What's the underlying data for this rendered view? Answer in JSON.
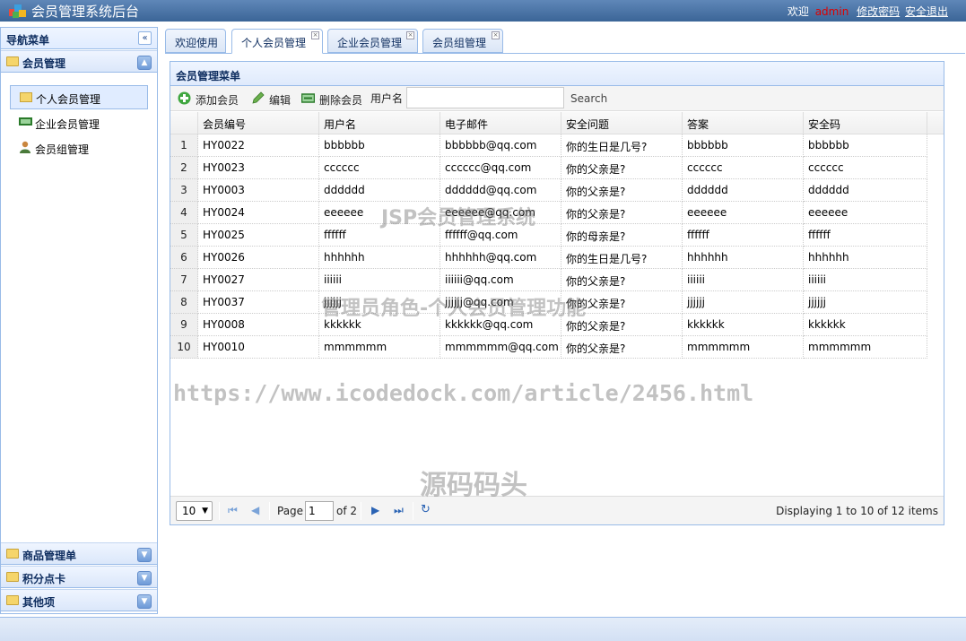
{
  "header": {
    "title": "会员管理系统后台",
    "welcome": "欢迎",
    "username": "admin",
    "change_password": "修改密码",
    "logout": "安全退出"
  },
  "nav": {
    "title": "导航菜单",
    "collapse_icon": "double-chevron-left-icon",
    "sections": [
      {
        "label": "会员管理",
        "items": [
          {
            "label": "个人会员管理",
            "icon": "folder-icon",
            "selected": true
          },
          {
            "label": "企业会员管理",
            "icon": "card-icon",
            "selected": false
          },
          {
            "label": "会员组管理",
            "icon": "user-icon",
            "selected": false
          }
        ]
      },
      {
        "label": "商品管理单"
      },
      {
        "label": "积分点卡"
      },
      {
        "label": "其他项"
      }
    ]
  },
  "tabs": [
    {
      "label": "欢迎使用",
      "closable": false,
      "active": false
    },
    {
      "label": "个人会员管理",
      "closable": true,
      "active": true
    },
    {
      "label": "企业会员管理",
      "closable": true,
      "active": false
    },
    {
      "label": "会员组管理",
      "closable": true,
      "active": false
    }
  ],
  "panel": {
    "title": "会员管理菜单",
    "toolbar": {
      "add": "添加会员",
      "edit": "编辑",
      "delete": "删除会员",
      "username_label": "用户名",
      "username_value": "",
      "search": "Search"
    }
  },
  "grid": {
    "columns": [
      "会员编号",
      "用户名",
      "电子邮件",
      "安全问题",
      "答案",
      "安全码"
    ],
    "rows": [
      [
        "1",
        "HY0022",
        "bbbbbb",
        "bbbbbb@qq.com",
        "你的生日是几号?",
        "bbbbbb",
        "bbbbbb"
      ],
      [
        "2",
        "HY0023",
        "cccccc",
        "cccccc@qq.com",
        "你的父亲是?",
        "cccccc",
        "cccccc"
      ],
      [
        "3",
        "HY0003",
        "dddddd",
        "dddddd@qq.com",
        "你的父亲是?",
        "dddddd",
        "dddddd"
      ],
      [
        "4",
        "HY0024",
        "eeeeee",
        "eeeeee@qq.com",
        "你的父亲是?",
        "eeeeee",
        "eeeeee"
      ],
      [
        "5",
        "HY0025",
        "ffffff",
        "ffffff@qq.com",
        "你的母亲是?",
        "ffffff",
        "ffffff"
      ],
      [
        "6",
        "HY0026",
        "hhhhhh",
        "hhhhhh@qq.com",
        "你的生日是几号?",
        "hhhhhh",
        "hhhhhh"
      ],
      [
        "7",
        "HY0027",
        "iiiiii",
        "iiiiii@qq.com",
        "你的父亲是?",
        "iiiiii",
        "iiiiii"
      ],
      [
        "8",
        "HY0037",
        "jjjjjj",
        "jjjjjj@qq.com",
        "你的父亲是?",
        "jjjjjj",
        "jjjjjj"
      ],
      [
        "9",
        "HY0008",
        "kkkkkk",
        "kkkkkk@qq.com",
        "你的父亲是?",
        "kkkkkk",
        "kkkkkk"
      ],
      [
        "10",
        "HY0010",
        "mmmmmm",
        "mmmmmm@qq.com",
        "你的父亲是?",
        "mmmmmm",
        "mmmmmm"
      ]
    ]
  },
  "pager": {
    "page_size": "10",
    "page_label": "Page",
    "page_value": "1",
    "of_label": "of 2",
    "info": "Displaying 1 to 10 of 12 items"
  },
  "watermarks": {
    "w1": "JSP会员管理系统",
    "w2": "管理员角色-个人会员管理功能",
    "w3": "https://www.icodedock.com/article/2456.html",
    "w4": "源码码头"
  },
  "colors": {
    "header_bg": "#3b6597",
    "border": "#99bbe8",
    "username": "#dd0000"
  }
}
